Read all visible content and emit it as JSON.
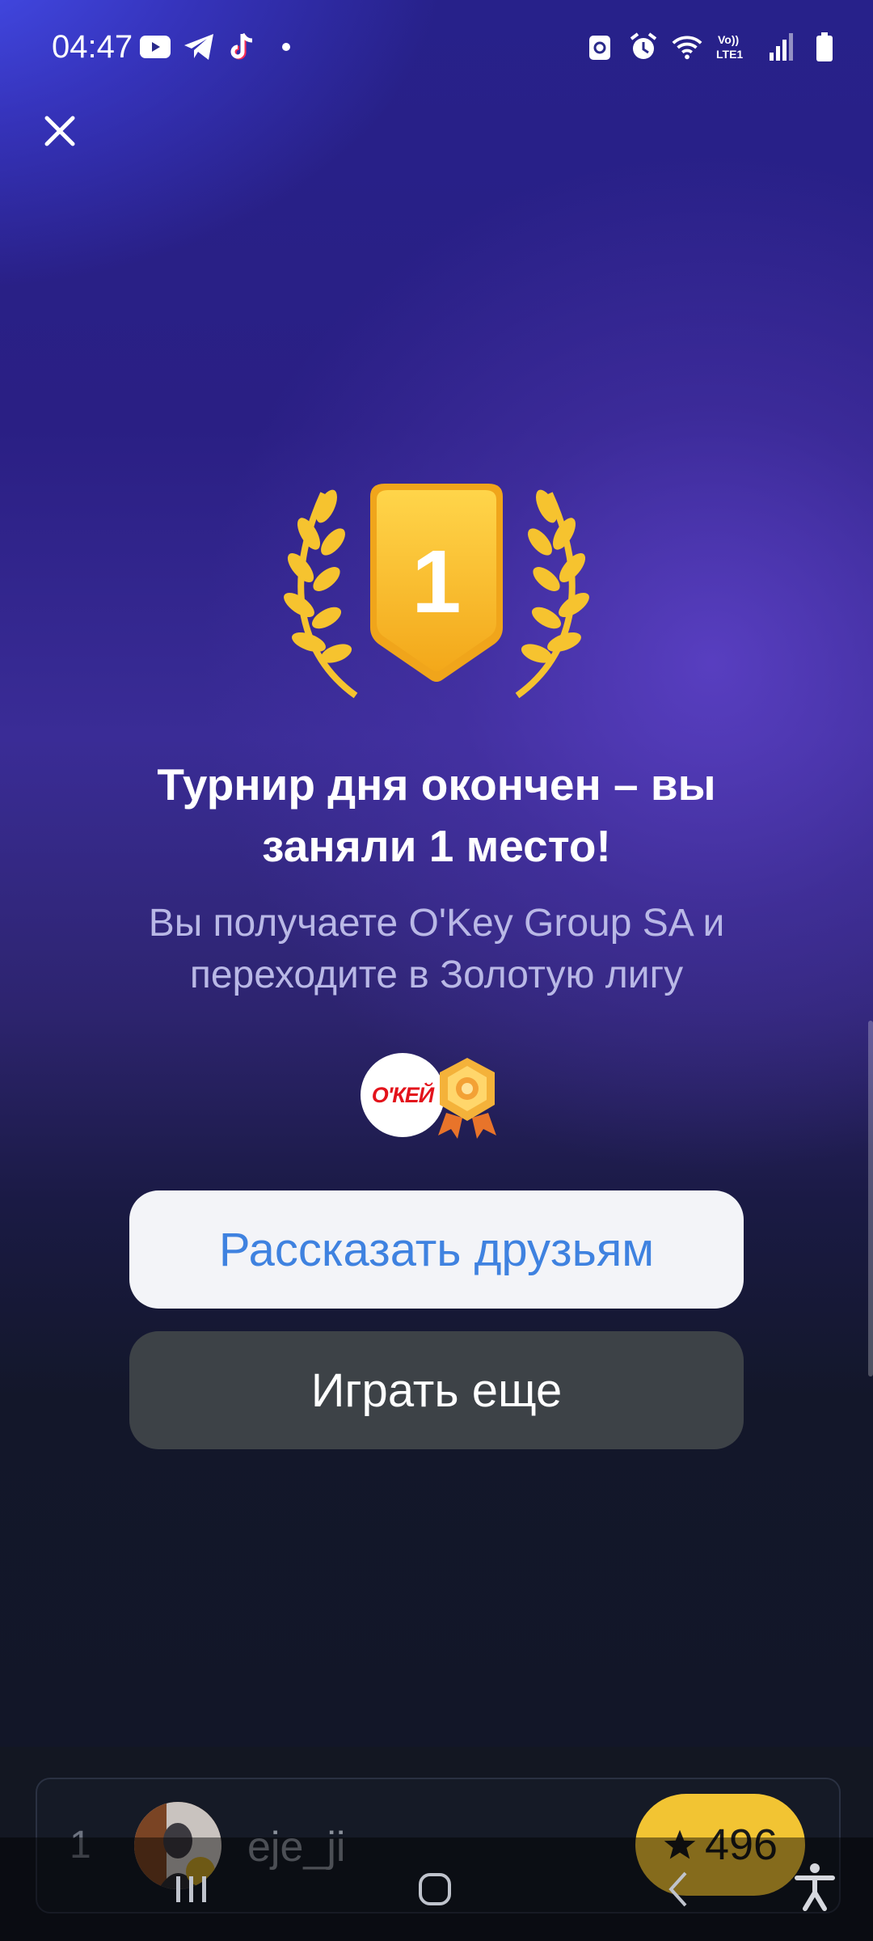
{
  "status_bar": {
    "time": "04:47",
    "left_icons": [
      "youtube-icon",
      "telegram-icon",
      "tiktok-icon",
      "dot-icon"
    ],
    "right_icons": [
      "nfc-icon",
      "alarm-icon",
      "wifi-icon",
      "volte-icon",
      "signal-icon",
      "battery-icon"
    ],
    "volte_label": "Vo)) LTE1"
  },
  "result": {
    "place_number": "1",
    "title": "Турнир дня окончен – вы заняли 1 место!",
    "subtitle": "Вы получаете O'Key Group SA и переходите в Золотую лигу",
    "reward_logo_text": "О'КЕЙ"
  },
  "buttons": {
    "share": "Рассказать друзьям",
    "play_again": "Играть еще"
  },
  "leaderboard": {
    "rank": "1",
    "username": "eje_ji",
    "score": "496"
  },
  "colors": {
    "gold": "#f6c32f",
    "share_text": "#3f82e0",
    "score_pill": "#f2c433"
  }
}
